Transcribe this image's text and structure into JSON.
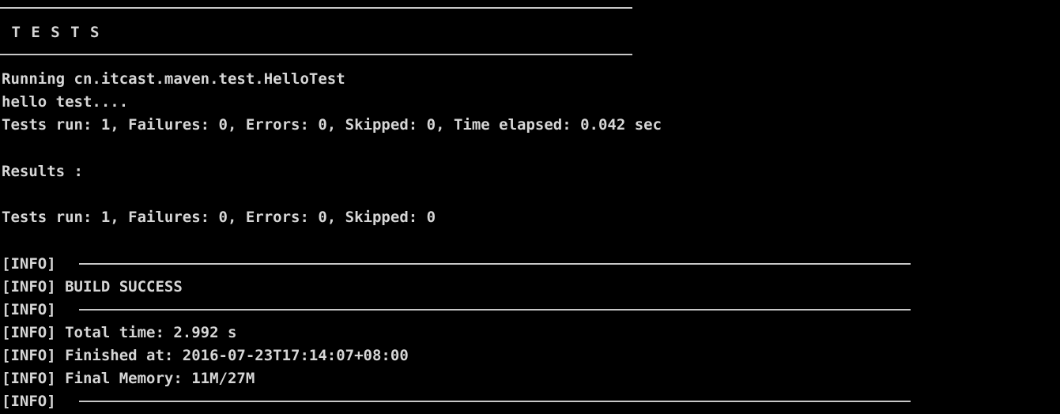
{
  "console": {
    "banner_title": " T E S T S",
    "lines": {
      "running": "Running cn.itcast.maven.test.HelloTest",
      "hello": "hello test....",
      "tests_run_detail": "Tests run: 1, Failures: 0, Errors: 0, Skipped: 0, Time elapsed: 0.042 sec",
      "results": "Results :",
      "tests_run_summary": "Tests run: 1, Failures: 0, Errors: 0, Skipped: 0",
      "info_prefix_1": "[INFO]",
      "build_success": "[INFO] BUILD SUCCESS",
      "info_prefix_2": "[INFO]",
      "total_time": "[INFO] Total time: 2.992 s",
      "finished_at": "[INFO] Finished at: 2016-07-23T17:14:07+08:00",
      "final_memory": "[INFO] Final Memory: 11M/27M",
      "info_prefix_3": "[INFO]"
    }
  }
}
